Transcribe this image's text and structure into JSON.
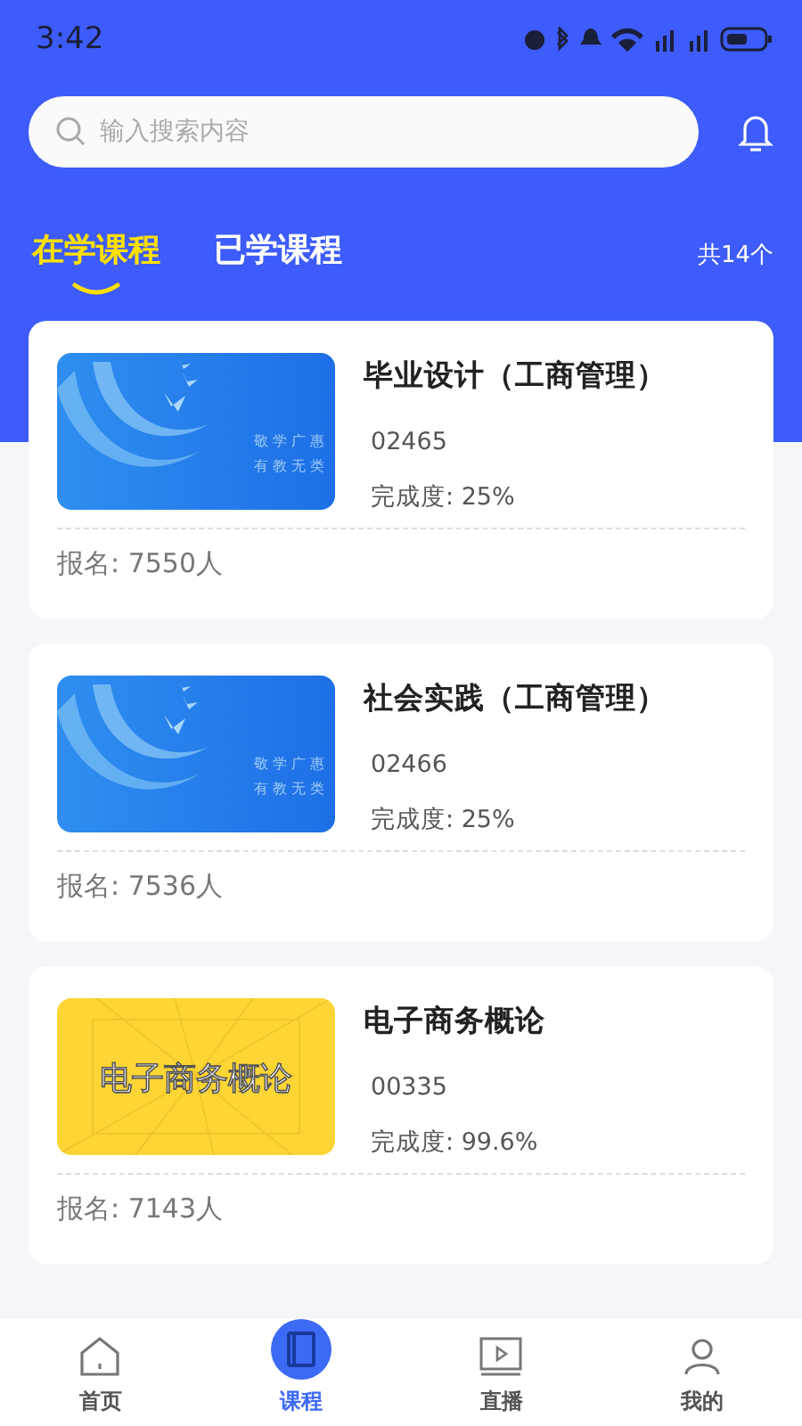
{
  "status_bar": {
    "time": "3:42"
  },
  "search": {
    "placeholder": "输入搜索内容"
  },
  "tabs": [
    {
      "label": "在学课程",
      "selected": true
    },
    {
      "label": "已学课程",
      "selected": false
    }
  ],
  "total": "共14个",
  "courses": [
    {
      "title": "毕业设计（工商管理）",
      "code": "02465",
      "progress": "完成度: 25%",
      "enrolled": "报名: 7550人",
      "cover": {
        "kind": "emblem",
        "lines": [
          "敬 学 广 惠",
          "有 教 无 类"
        ]
      }
    },
    {
      "title": "社会实践（工商管理）",
      "code": "02466",
      "progress": "完成度: 25%",
      "enrolled": "报名: 7536人",
      "cover": {
        "kind": "emblem",
        "lines": [
          "敬 学 广 惠",
          "有 教 无 类"
        ]
      }
    },
    {
      "title": "电子商务概论",
      "code": "00335",
      "progress": "完成度: 99.6%",
      "enrolled": "报名: 7143人",
      "cover": {
        "kind": "title",
        "lines": [
          "电子商务概论"
        ]
      }
    }
  ],
  "nav": [
    {
      "label": "首页",
      "kind": "home",
      "selected": false
    },
    {
      "label": "课程",
      "kind": "book",
      "selected": true
    },
    {
      "label": "直播",
      "kind": "video",
      "selected": false
    },
    {
      "label": "我的",
      "kind": "user",
      "selected": false
    }
  ]
}
